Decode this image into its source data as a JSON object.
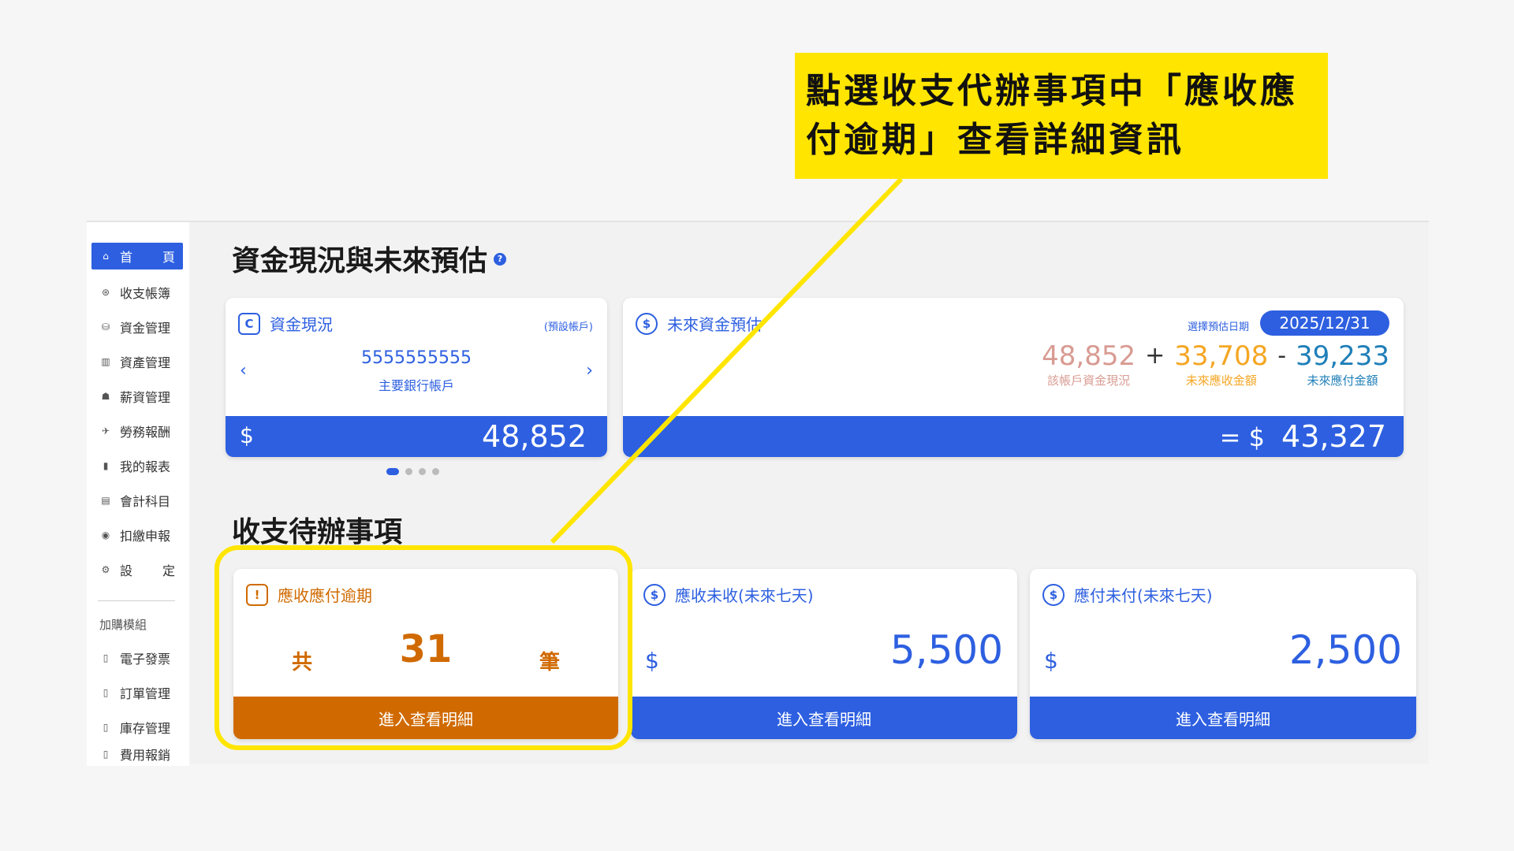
{
  "sidebar": {
    "home": {
      "icon": "home-icon",
      "char1": "首",
      "char2": "頁"
    },
    "items": [
      {
        "icon": "dollar-circle-icon",
        "label": "收支帳簿"
      },
      {
        "icon": "fund-icon",
        "label": "資金管理"
      },
      {
        "icon": "asset-icon",
        "label": "資產管理"
      },
      {
        "icon": "salary-icon",
        "label": "薪資管理"
      },
      {
        "icon": "labor-icon",
        "label": "勞務報酬"
      },
      {
        "icon": "report-icon",
        "label": "我的報表"
      },
      {
        "icon": "ledger-icon",
        "label": "會計科目"
      },
      {
        "icon": "tax-icon",
        "label": "扣繳申報"
      },
      {
        "icon": "settings-icon",
        "label_a": "設",
        "label_b": "定"
      }
    ],
    "addon_group": "加購模組",
    "addons": [
      {
        "icon": "module-icon",
        "label": "電子發票"
      },
      {
        "icon": "module-icon",
        "label": "訂單管理"
      },
      {
        "icon": "module-icon",
        "label": "庫存管理"
      },
      {
        "icon": "module-icon",
        "label": "費用報銷"
      }
    ]
  },
  "funds": {
    "title": "資金現況與未來預估",
    "current": {
      "heading": "資金現況",
      "tag": "(預設帳戶)",
      "account_number": "5555555555",
      "account_name": "主要銀行帳戶",
      "currency": "$",
      "balance": "48,852"
    },
    "future": {
      "heading": "未來資金預估",
      "date_label": "選擇預估日期",
      "date": "2025/12/31",
      "balance": "48,852",
      "balance_label": "該帳戶資金現況",
      "plus": "+",
      "receivable": "33,708",
      "receivable_label": "未來應收金額",
      "minus": "-",
      "payable": "39,233",
      "payable_label": "未來應付金額",
      "result_prefix": "= $",
      "result": "43,327"
    },
    "colors": {
      "balance": "#d89b92",
      "receivable": "#f5a623",
      "payable": "#1f7fb8"
    }
  },
  "todo": {
    "title": "收支待辦事項",
    "overdue": {
      "heading": "應收應付逾期",
      "prefix": "共",
      "count": "31",
      "suffix": "筆",
      "button": "進入查看明細"
    },
    "receivable": {
      "heading": "應收未收(未來七天)",
      "currency": "$",
      "amount": "5,500",
      "button": "進入查看明細"
    },
    "payable": {
      "heading": "應付未付(未來七天)",
      "currency": "$",
      "amount": "2,500",
      "button": "進入查看明細"
    }
  },
  "annotation": {
    "line1": "點選收支代辦事項中「應收應",
    "line2": "付逾期」查看詳細資訊"
  },
  "colors": {
    "primary": "#2d5fe0",
    "overdue": "#d06a00",
    "highlight": "#ffe500"
  }
}
